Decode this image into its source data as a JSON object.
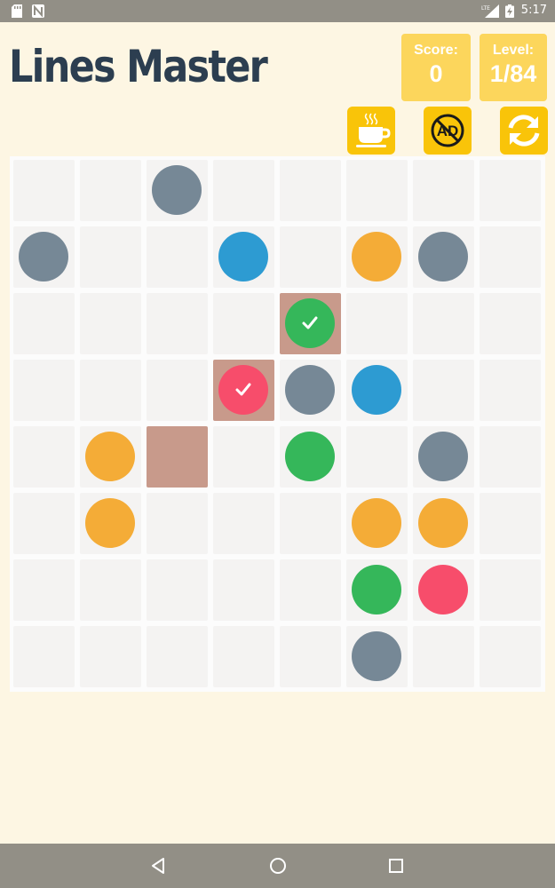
{
  "status_bar": {
    "time": "5:17",
    "left_icons": [
      "sd-card-icon",
      "n-icon"
    ],
    "right_icons": [
      "lte-signal-icon",
      "battery-charging-icon"
    ]
  },
  "app": {
    "title": "Lines Master"
  },
  "score": {
    "label": "Score:",
    "value": "0"
  },
  "level": {
    "label": "Level:",
    "value": "1/84"
  },
  "toolbar": {
    "buttons": [
      {
        "name": "coffee-button",
        "icon": "coffee-cup-icon"
      },
      {
        "name": "no-ads-button",
        "icon": "no-ads-icon",
        "text": "AD"
      },
      {
        "name": "restart-button",
        "icon": "refresh-icon"
      }
    ]
  },
  "colors": {
    "gray": "#768896",
    "blue": "#2d9bd2",
    "orange": "#f4ac37",
    "green": "#35b75a",
    "red": "#f74d6b",
    "highlight": "#c89a8b",
    "accent": "#f9c409"
  },
  "board": {
    "rows": 8,
    "cols": 8,
    "balls": [
      {
        "row": 0,
        "col": 2,
        "color": "gray"
      },
      {
        "row": 1,
        "col": 0,
        "color": "gray"
      },
      {
        "row": 1,
        "col": 3,
        "color": "blue"
      },
      {
        "row": 1,
        "col": 5,
        "color": "orange"
      },
      {
        "row": 1,
        "col": 6,
        "color": "gray"
      },
      {
        "row": 2,
        "col": 4,
        "color": "green",
        "marked": true
      },
      {
        "row": 3,
        "col": 3,
        "color": "red",
        "marked": true
      },
      {
        "row": 3,
        "col": 4,
        "color": "gray"
      },
      {
        "row": 3,
        "col": 5,
        "color": "blue"
      },
      {
        "row": 4,
        "col": 1,
        "color": "orange"
      },
      {
        "row": 4,
        "col": 4,
        "color": "green"
      },
      {
        "row": 4,
        "col": 6,
        "color": "gray"
      },
      {
        "row": 5,
        "col": 1,
        "color": "orange"
      },
      {
        "row": 5,
        "col": 5,
        "color": "orange"
      },
      {
        "row": 5,
        "col": 6,
        "color": "orange"
      },
      {
        "row": 6,
        "col": 5,
        "color": "green"
      },
      {
        "row": 6,
        "col": 6,
        "color": "red"
      },
      {
        "row": 7,
        "col": 5,
        "color": "gray"
      }
    ],
    "highlighted_cells": [
      {
        "row": 2,
        "col": 4
      },
      {
        "row": 3,
        "col": 3
      },
      {
        "row": 4,
        "col": 2
      }
    ]
  },
  "nav_bar": {
    "buttons": [
      "back-icon",
      "home-icon",
      "recents-icon"
    ]
  }
}
